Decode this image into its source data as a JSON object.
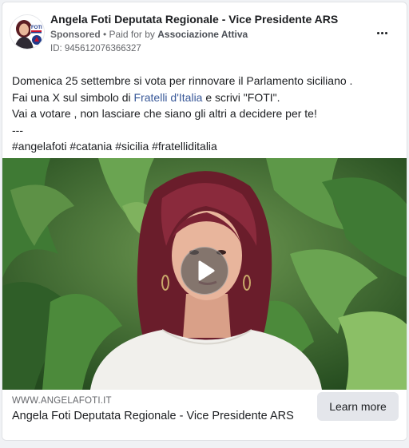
{
  "ad": {
    "page_name": "Angela Foti Deputata Regionale - Vice Presidente ARS",
    "sponsored_label": "Sponsored",
    "separator": " • ",
    "paid_for_prefix": "Paid for by ",
    "payer": "Associazione Attiva",
    "id_text": "ID: 945612076366327",
    "avatar_badge_text": "FOTI",
    "more_icon": "more-horizontal-icon"
  },
  "body": {
    "line1": "Domenica 25 settembre si vota per rinnovare il Parlamento siciliano .",
    "line2_before": "Fai una X sul simbolo di ",
    "line2_link": "Fratelli d'Italia",
    "line2_after": " e scrivi \"FOTI\".",
    "line3": "Vai a votare , non lasciare che siano gli altri a decidere per te!",
    "line4": "---",
    "hashtags": "#angelafoti #catania #sicilia #fratelliditalia"
  },
  "video": {
    "play_icon": "play-icon"
  },
  "footer": {
    "domain": "WWW.ANGELAFOTI.IT",
    "title": "Angela Foti Deputata Regionale - Vice Presidente ARS",
    "cta_label": "Learn more"
  },
  "colors": {
    "link": "#385898",
    "text": "#1c1e21",
    "secondary": "#65676b",
    "cta_bg": "#e4e6eb"
  }
}
